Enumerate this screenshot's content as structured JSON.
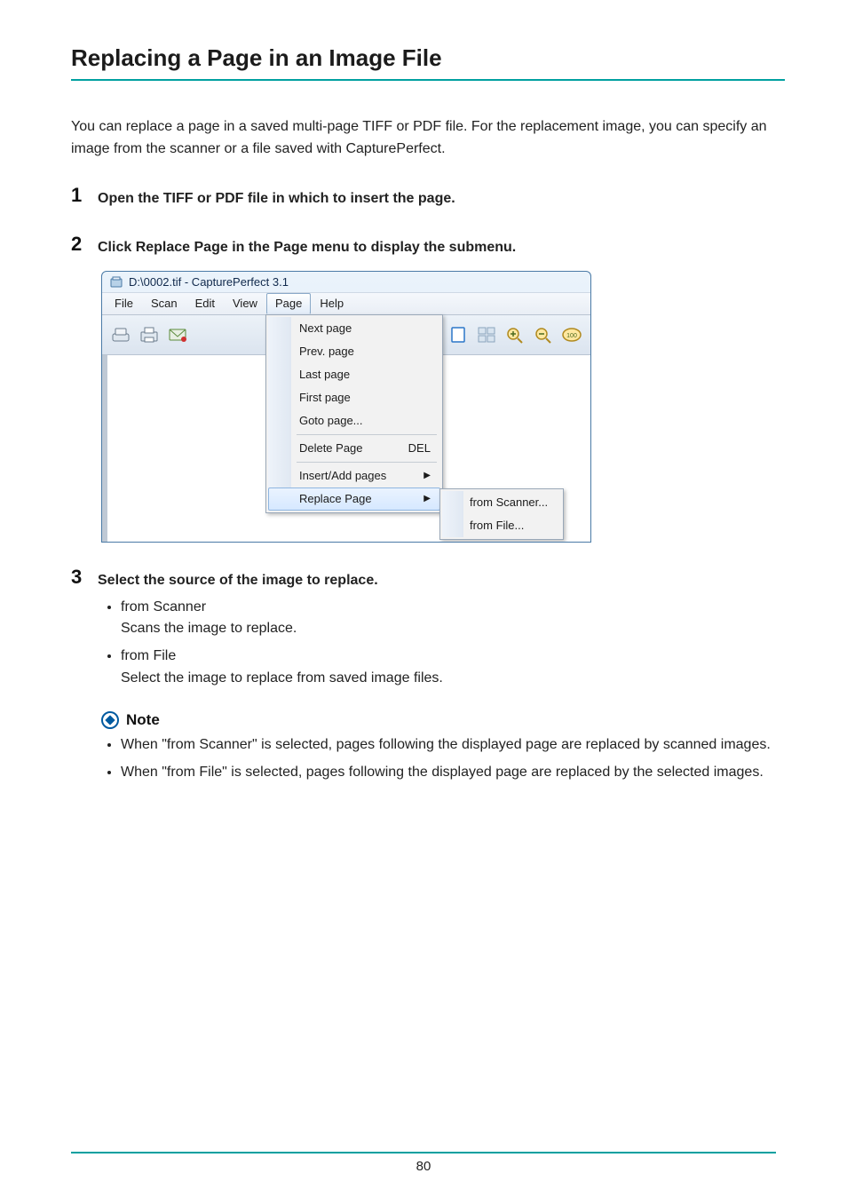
{
  "title": "Replacing a Page in an Image File",
  "intro": "You can replace a page in a saved multi-page TIFF or PDF file. For the replacement image, you can specify an image from the scanner or a file saved with CapturePerfect.",
  "steps": {
    "s1": {
      "num": "1",
      "text": "Open the TIFF or PDF file in which to insert the page."
    },
    "s2": {
      "num": "2",
      "text": "Click Replace Page in the Page menu to display the submenu."
    },
    "s3": {
      "num": "3",
      "text": "Select the source of the image to replace."
    }
  },
  "step3_items": [
    {
      "label": "from Scanner",
      "detail": "Scans the image to replace."
    },
    {
      "label": "from File",
      "detail": "Select the image to replace from saved image files."
    }
  ],
  "note_label": "Note",
  "notes": [
    "When \"from Scanner\" is selected, pages following the displayed page are replaced by scanned images.",
    "When \"from File\" is selected, pages following the displayed page are replaced by the selected images."
  ],
  "window": {
    "title": "D:\\0002.tif - CapturePerfect 3.1",
    "menus": {
      "file": "File",
      "scan": "Scan",
      "edit": "Edit",
      "view": "View",
      "page": "Page",
      "help": "Help"
    },
    "page_menu": {
      "next": "Next page",
      "prev": "Prev. page",
      "last": "Last page",
      "first": "First page",
      "goto": "Goto page...",
      "delete": "Delete Page",
      "delete_shortcut": "DEL",
      "insert": "Insert/Add pages",
      "replace": "Replace Page"
    },
    "replace_submenu": {
      "scanner": "from Scanner...",
      "file": "from File..."
    }
  },
  "page_number": "80"
}
